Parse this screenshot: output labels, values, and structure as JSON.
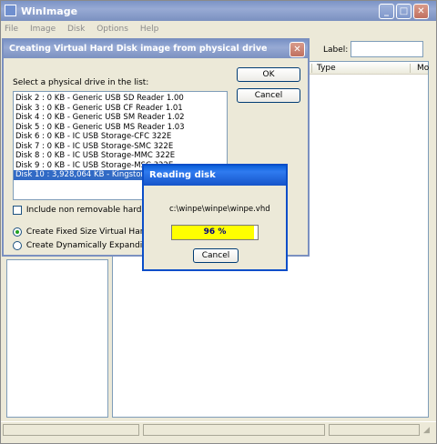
{
  "main": {
    "title": "WinImage",
    "menu": [
      "File",
      "Image",
      "Disk",
      "Options",
      "Help"
    ],
    "label_caption": "Label:",
    "label_value": "",
    "columns": [
      "Type",
      "Mo"
    ]
  },
  "create_dialog": {
    "title": "Creating Virtual Hard Disk image from physical drive",
    "instruction": "Select a physical drive in the list:",
    "ok_label": "OK",
    "cancel_label": "Cancel",
    "drives": [
      "Disk 2 : 0 KB - Generic USB SD Reader 1.00",
      "Disk 3 : 0 KB - Generic USB CF Reader 1.01",
      "Disk 4 : 0 KB - Generic USB SM Reader 1.02",
      "Disk 5 : 0 KB - Generic USB MS Reader 1.03",
      "Disk 6 : 0 KB - IC USB Storage-CFC 322E",
      "Disk 7 : 0 KB - IC USB Storage-SMC 322E",
      "Disk 8 : 0 KB - IC USB Storage-MMC 322E",
      "Disk 9 : 0 KB - IC USB Storage-MSC 322E",
      "Disk 10 : 3,928,064 KB - Kingston Da"
    ],
    "selected_drive_index": 8,
    "include_checkbox_label": "Include non removable hard disk(s",
    "include_checked": false,
    "radio_fixed_label": "Create Fixed Size Virtual Hard Disk",
    "radio_dynamic_label": "Create Dynamically Expanding Virt",
    "selected_radio": "fixed"
  },
  "reading_dialog": {
    "title": "Reading disk",
    "path": "c:\\winpe\\winpe\\winpe.vhd",
    "progress_text": "96 %",
    "progress_fraction": 0.96,
    "cancel_label": "Cancel",
    "progress_color": "#ffff00"
  }
}
